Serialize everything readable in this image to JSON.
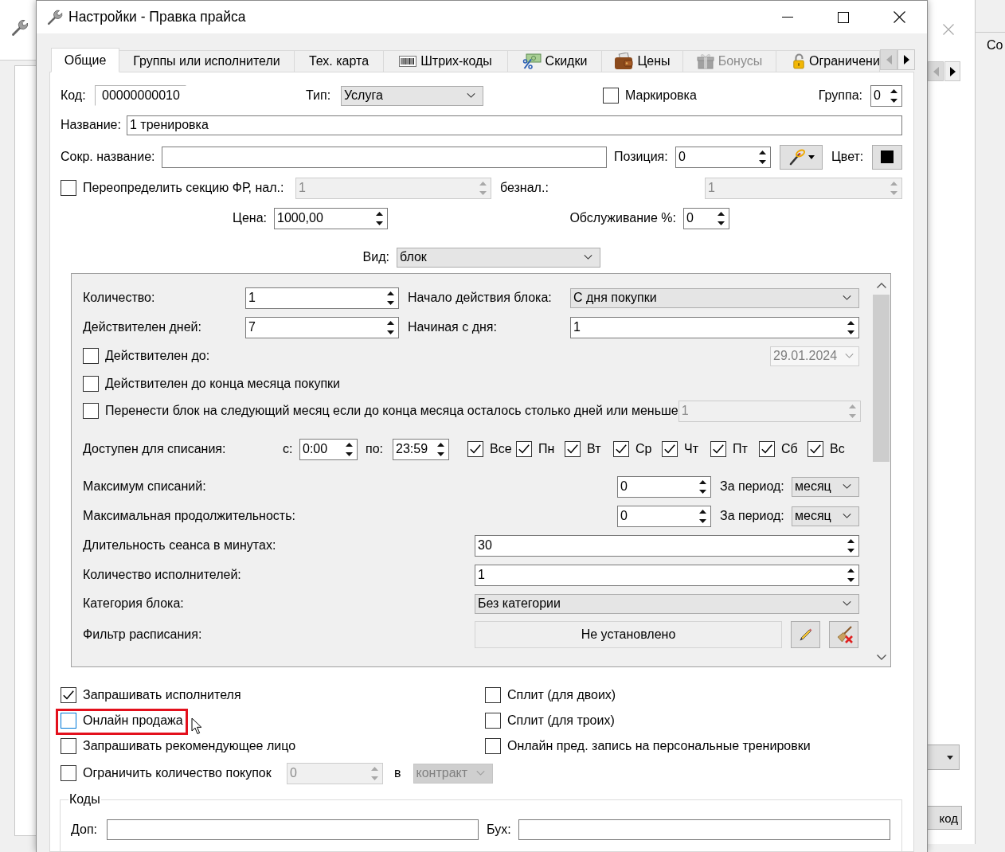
{
  "background_windows": {
    "label": "Со",
    "button": "код"
  },
  "window": {
    "title": "Настройки - Правка прайса"
  },
  "tabs": [
    {
      "label": "Общие",
      "selected": true,
      "disabled": false
    },
    {
      "label": "Группы или исполнители",
      "selected": false,
      "disabled": false
    },
    {
      "label": "Тех. карта",
      "selected": false,
      "disabled": false
    },
    {
      "label": "Штрих-коды",
      "selected": false,
      "disabled": false
    },
    {
      "label": "Скидки",
      "selected": false,
      "disabled": false
    },
    {
      "label": "Цены",
      "selected": false,
      "disabled": false
    },
    {
      "label": "Бонусы",
      "selected": false,
      "disabled": true
    },
    {
      "label": "Ограничени",
      "selected": false,
      "disabled": false
    }
  ],
  "tab_scroll": {
    "back_disabled": true,
    "forward_disabled": false
  },
  "general": {
    "code": {
      "label": "Код:",
      "value": "00000000010"
    },
    "type": {
      "label": "Тип:",
      "value": "Услуга"
    },
    "marking": {
      "label": "Маркировка",
      "checked": false
    },
    "group": {
      "label": "Группа:",
      "value": "0"
    },
    "name": {
      "label": "Название:",
      "value": "1 тренировка"
    },
    "short_name": {
      "label": "Сокр. название:"
    },
    "position": {
      "label": "Позиция:",
      "value": "0"
    },
    "color": {
      "label": "Цвет:",
      "color": "#000000"
    },
    "fr_section": {
      "label": "Переопределить секцию ФР, нал.:",
      "checked": false,
      "value": "1",
      "disabled": true
    },
    "cashless": {
      "label": "безнал.:",
      "value": "1",
      "disabled": true
    },
    "price": {
      "label": "Цена:",
      "value": "1000,00"
    },
    "service": {
      "label": "Обслуживание %:",
      "value": "0"
    },
    "view": {
      "label": "Вид:",
      "value": "блок"
    }
  },
  "block": {
    "quantity": {
      "label": "Количество:",
      "value": "1"
    },
    "start": {
      "label": "Начало действия блока:",
      "value": "С дня покупки"
    },
    "valid_days": {
      "label": "Действителен дней:",
      "value": "7"
    },
    "from_day": {
      "label": "Начиная с дня:",
      "value": "1"
    },
    "valid_until": {
      "label": "Действителен до:",
      "checked": false,
      "date": "29.01.2024",
      "disabled": true
    },
    "month_end": {
      "label": "Действителен до конца месяца покупки",
      "checked": false
    },
    "carry_over": {
      "label": "Перенести блок на следующий месяц если до конца месяца осталось столько дней или меньше",
      "checked": false,
      "value": "1",
      "disabled": true
    },
    "available": {
      "label": "Доступен для списания:",
      "from_label": "с:",
      "from": "0:00",
      "to_label": "по:",
      "to": "23:59",
      "days": [
        {
          "label": "Все",
          "checked": true
        },
        {
          "label": "Пн",
          "checked": true
        },
        {
          "label": "Вт",
          "checked": true
        },
        {
          "label": "Ср",
          "checked": true
        },
        {
          "label": "Чт",
          "checked": true
        },
        {
          "label": "Пт",
          "checked": true
        },
        {
          "label": "Сб",
          "checked": true
        },
        {
          "label": "Вс",
          "checked": true
        }
      ]
    },
    "limits": [
      {
        "label": "Максимум списаний:",
        "value": "0",
        "period_label": "За период:",
        "period": "месяц"
      },
      {
        "label": "Максимальная продолжительность:",
        "value": "0",
        "period_label": "За период:",
        "period": "месяц"
      }
    ],
    "session_length": {
      "label": "Длительность сеанса в минутах:",
      "value": "30"
    },
    "performers": {
      "label": "Количество исполнителей:",
      "value": "1"
    },
    "category": {
      "label": "Категория блока:",
      "value": "Без категории"
    },
    "schedule_filter": {
      "label": "Фильтр расписания:",
      "value": "Не установлено"
    }
  },
  "options": {
    "left": [
      {
        "label": "Запрашивать исполнителя",
        "checked": true,
        "hovered": false,
        "highlighted": false
      },
      {
        "label": "Онлайн продажа",
        "checked": false,
        "hovered": true,
        "highlighted": true
      },
      {
        "label": "Запрашивать рекомендующее лицо",
        "checked": false,
        "hovered": false,
        "highlighted": false
      }
    ],
    "right": [
      {
        "label": "Сплит (для двоих)",
        "checked": false,
        "hovered": false,
        "highlighted": false
      },
      {
        "label": "Сплит (для троих)",
        "checked": false,
        "hovered": false,
        "highlighted": false
      },
      {
        "label": "Онлайн пред. запись на персональные тренировки",
        "checked": false,
        "hovered": false,
        "highlighted": false
      }
    ],
    "purchase_limit": {
      "label": "Ограничить количество покупок",
      "checked": false,
      "value": "0",
      "disabled": true,
      "in_label": "в",
      "unit": "контракт"
    }
  },
  "codes": {
    "title": "Коды",
    "extra": {
      "label": "Доп:"
    },
    "accounting": {
      "label": "Бух:"
    }
  }
}
